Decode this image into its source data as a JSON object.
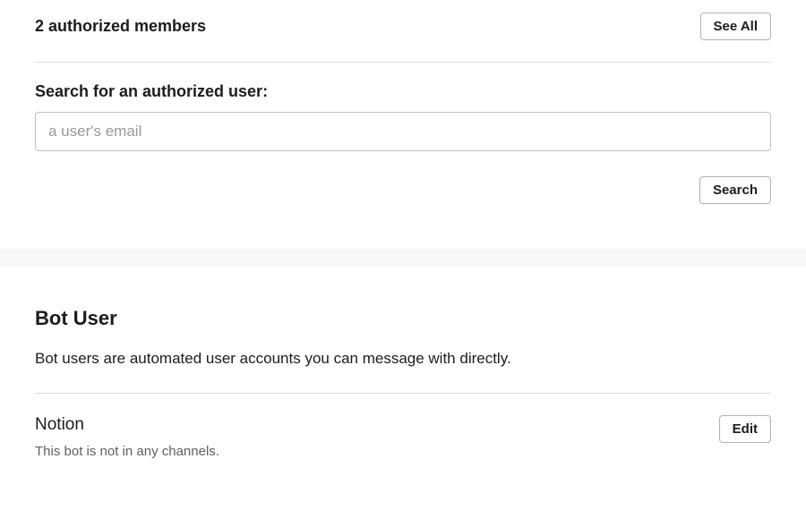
{
  "authorized": {
    "count_label": "2 authorized members",
    "see_all": "See All",
    "search_label": "Search for an authorized user:",
    "placeholder": "a user's email",
    "search_button": "Search"
  },
  "bot_user": {
    "heading": "Bot User",
    "description": "Bot users are automated user accounts you can message with directly.",
    "name": "Notion",
    "status": "This bot is not in any channels.",
    "edit": "Edit"
  }
}
